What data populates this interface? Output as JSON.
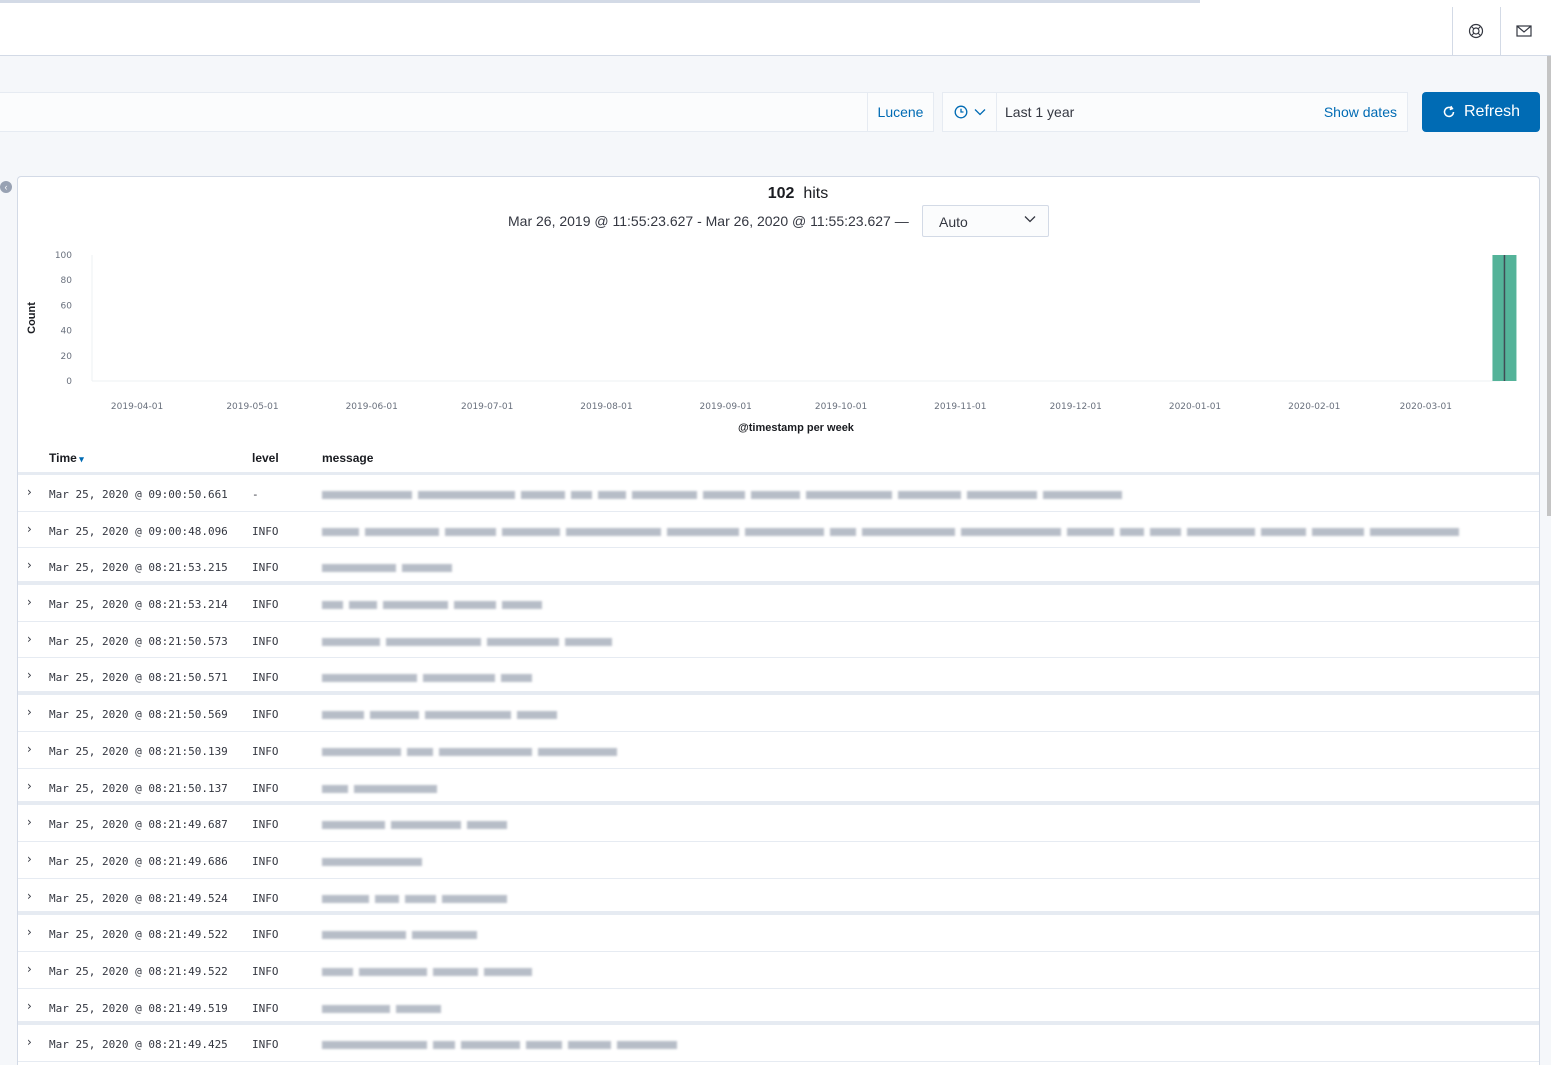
{
  "query": {
    "language_label": "Lucene"
  },
  "datepicker": {
    "value": "Last 1 year",
    "show_dates": "Show dates"
  },
  "refresh": {
    "label": "Refresh"
  },
  "summary": {
    "hits_count": "102",
    "hits_label": "hits",
    "range": "Mar 26, 2019 @ 11:55:23.627 - Mar 26, 2020 @ 11:55:23.627 —",
    "interval": "Auto"
  },
  "chart_data": {
    "type": "bar",
    "ylabel": "Count",
    "xlabel": "@timestamp per week",
    "ylim": [
      0,
      100
    ],
    "yticks": [
      "100",
      "80",
      "60",
      "40",
      "20",
      "0"
    ],
    "xticks": [
      "2019-04-01",
      "2019-05-01",
      "2019-06-01",
      "2019-07-01",
      "2019-08-01",
      "2019-09-01",
      "2019-10-01",
      "2019-11-01",
      "2019-12-01",
      "2020-01-01",
      "2020-02-01",
      "2020-03-01"
    ],
    "x": [
      "2020-03-23"
    ],
    "values": [
      102
    ],
    "bar_color": "#54b399"
  },
  "table": {
    "columns": [
      "Time",
      "level",
      "message"
    ],
    "rows": [
      {
        "time": "Mar 25, 2020 @ 09:00:50.661",
        "level": "-",
        "msg_len": 800
      },
      {
        "time": "Mar 25, 2020 @ 09:00:48.096",
        "level": "INFO",
        "msg_len": 1140
      },
      {
        "time": "Mar 25, 2020 @ 08:21:53.215",
        "level": "INFO",
        "msg_len": 130
      },
      {
        "time": "Mar 25, 2020 @ 08:21:53.214",
        "level": "INFO",
        "msg_len": 220
      },
      {
        "time": "Mar 25, 2020 @ 08:21:50.573",
        "level": "INFO",
        "msg_len": 290
      },
      {
        "time": "Mar 25, 2020 @ 08:21:50.571",
        "level": "INFO",
        "msg_len": 210
      },
      {
        "time": "Mar 25, 2020 @ 08:21:50.569",
        "level": "INFO",
        "msg_len": 235
      },
      {
        "time": "Mar 25, 2020 @ 08:21:50.139",
        "level": "INFO",
        "msg_len": 295
      },
      {
        "time": "Mar 25, 2020 @ 08:21:50.137",
        "level": "INFO",
        "msg_len": 115
      },
      {
        "time": "Mar 25, 2020 @ 08:21:49.687",
        "level": "INFO",
        "msg_len": 185
      },
      {
        "time": "Mar 25, 2020 @ 08:21:49.686",
        "level": "INFO",
        "msg_len": 115
      },
      {
        "time": "Mar 25, 2020 @ 08:21:49.524",
        "level": "INFO",
        "msg_len": 185
      },
      {
        "time": "Mar 25, 2020 @ 08:21:49.522",
        "level": "INFO",
        "msg_len": 155
      },
      {
        "time": "Mar 25, 2020 @ 08:21:49.522",
        "level": "INFO",
        "msg_len": 210
      },
      {
        "time": "Mar 25, 2020 @ 08:21:49.519",
        "level": "INFO",
        "msg_len": 135
      },
      {
        "time": "Mar 25, 2020 @ 08:21:49.425",
        "level": "INFO",
        "msg_len": 355
      }
    ]
  }
}
